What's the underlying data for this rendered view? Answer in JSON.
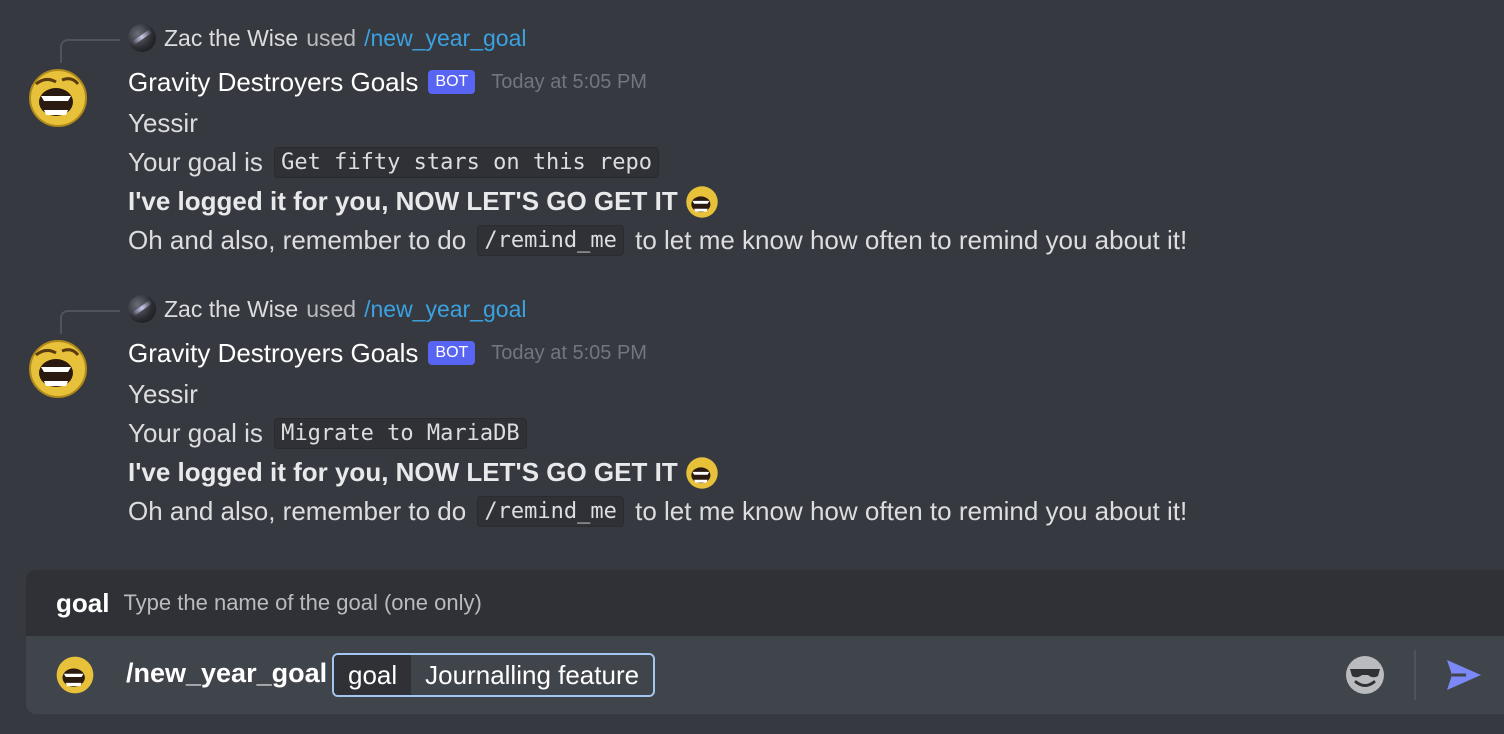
{
  "messages": [
    {
      "interaction": {
        "user": "Zac the Wise",
        "verb": "used",
        "command": "/new_year_goal"
      },
      "author": "Gravity Destroyers Goals",
      "bot_tag": "BOT",
      "timestamp": "Today at 5:05 PM",
      "line1": "Yessir",
      "line2_prefix": "Your goal is",
      "goal": "Get fifty stars on this repo",
      "line3": "I've logged it for you, NOW LET'S GO GET IT",
      "line4_prefix": "Oh and also, remember to do",
      "line4_code": "/remind_me",
      "line4_suffix": "to let me know how often to remind you about it!"
    },
    {
      "interaction": {
        "user": "Zac the Wise",
        "verb": "used",
        "command": "/new_year_goal"
      },
      "author": "Gravity Destroyers Goals",
      "bot_tag": "BOT",
      "timestamp": "Today at 5:05 PM",
      "line1": "Yessir",
      "line2_prefix": "Your goal is",
      "goal": "Migrate to MariaDB",
      "line3": "I've logged it for you, NOW LET'S GO GET IT",
      "line4_prefix": "Oh and also, remember to do",
      "line4_code": "/remind_me",
      "line4_suffix": "to let me know how often to remind you about it!"
    }
  ],
  "option_hint": {
    "name": "goal",
    "description": "Type the name of the goal (one only)"
  },
  "composer": {
    "command": "/new_year_goal",
    "option_key": "goal",
    "option_value": "Journalling feature"
  },
  "icons": {
    "bot_avatar": "screaming-face-avatar",
    "user_avatar": "galaxy-avatar",
    "emoji_button": "sunglasses-face-icon",
    "send": "send-arrow-icon"
  },
  "colors": {
    "background": "#36393f",
    "bot_tag": "#5865f2",
    "command_link": "#3ba1e0",
    "send": "#7b88f5"
  }
}
